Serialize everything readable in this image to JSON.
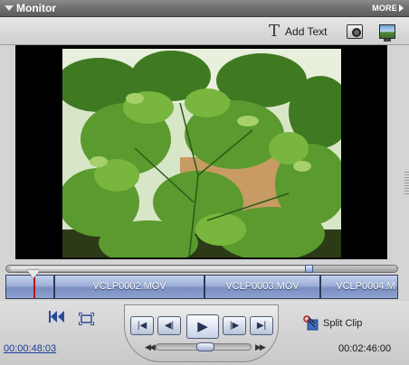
{
  "panel": {
    "title": "Monitor",
    "more_label": "MORE"
  },
  "toolbar": {
    "add_text_label": "Add Text",
    "icons": [
      "text-tool-icon",
      "freeze-frame-icon",
      "monitor-display-icon"
    ]
  },
  "preview": {
    "content": "plant-leaves-video-frame"
  },
  "timeline": {
    "scrub_position": 0.78,
    "playhead_clip_progress": 0.18,
    "clips": [
      "VCLP0002.MOV",
      "VCLP0003.MOV",
      "VCLP0004.M"
    ]
  },
  "transport": {
    "buttons": [
      "go-to-beginning",
      "step-back",
      "play",
      "step-forward",
      "go-to-end"
    ]
  },
  "split_clip_label": "Split Clip",
  "time": {
    "current": "00:00:48:03",
    "total": "00:02:46:00"
  },
  "colors": {
    "accent": "#1d3d9a",
    "clip": "#8ea2d0",
    "playhead": "#c0101a"
  }
}
